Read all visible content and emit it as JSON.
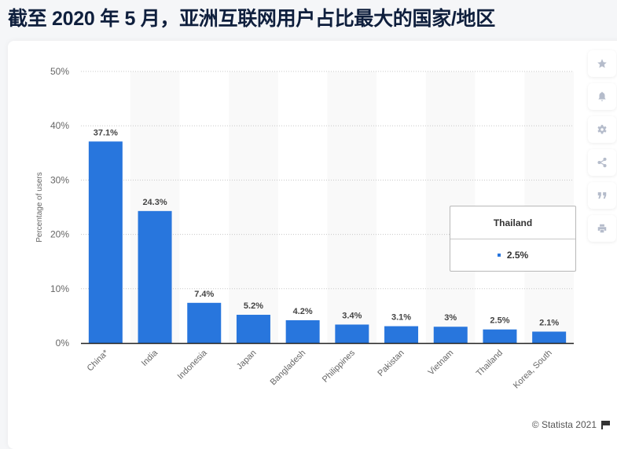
{
  "title": "截至 2020 年 5 月，亚洲互联网用户占比最大的国家/地区",
  "chart_data": {
    "type": "bar",
    "title": "截至 2020 年 5 月，亚洲互联网用户占比最大的国家/地区",
    "xlabel": "",
    "ylabel": "Percentage of users",
    "categories": [
      "China*",
      "India",
      "Indonesia",
      "Japan",
      "Bangladesh",
      "Philippines",
      "Pakistan",
      "Vietnam",
      "Thailand",
      "Korea, South"
    ],
    "values": [
      37.1,
      24.3,
      7.4,
      5.2,
      4.2,
      3.4,
      3.1,
      3.0,
      2.5,
      2.1
    ],
    "data_labels": [
      "37.1%",
      "24.3%",
      "7.4%",
      "5.2%",
      "4.2%",
      "3.4%",
      "3.1%",
      "3%",
      "2.5%",
      "2.1%"
    ],
    "ylim": [
      0,
      50
    ],
    "yticks": [
      0,
      10,
      20,
      30,
      40,
      50
    ],
    "ytick_labels": [
      "0%",
      "10%",
      "20%",
      "30%",
      "40%",
      "50%"
    ],
    "grid": true,
    "bar_color": "#2876dd",
    "legend": "none"
  },
  "tooltip": {
    "title": "Thailand",
    "value": "2.5%"
  },
  "sidebar": {
    "buttons": [
      {
        "name": "favorite",
        "icon": "star-icon"
      },
      {
        "name": "notify",
        "icon": "bell-icon"
      },
      {
        "name": "settings",
        "icon": "gear-icon"
      },
      {
        "name": "share",
        "icon": "share-icon"
      },
      {
        "name": "cite",
        "icon": "quote-icon"
      },
      {
        "name": "print",
        "icon": "print-icon"
      }
    ]
  },
  "credit": "© Statista 2021"
}
